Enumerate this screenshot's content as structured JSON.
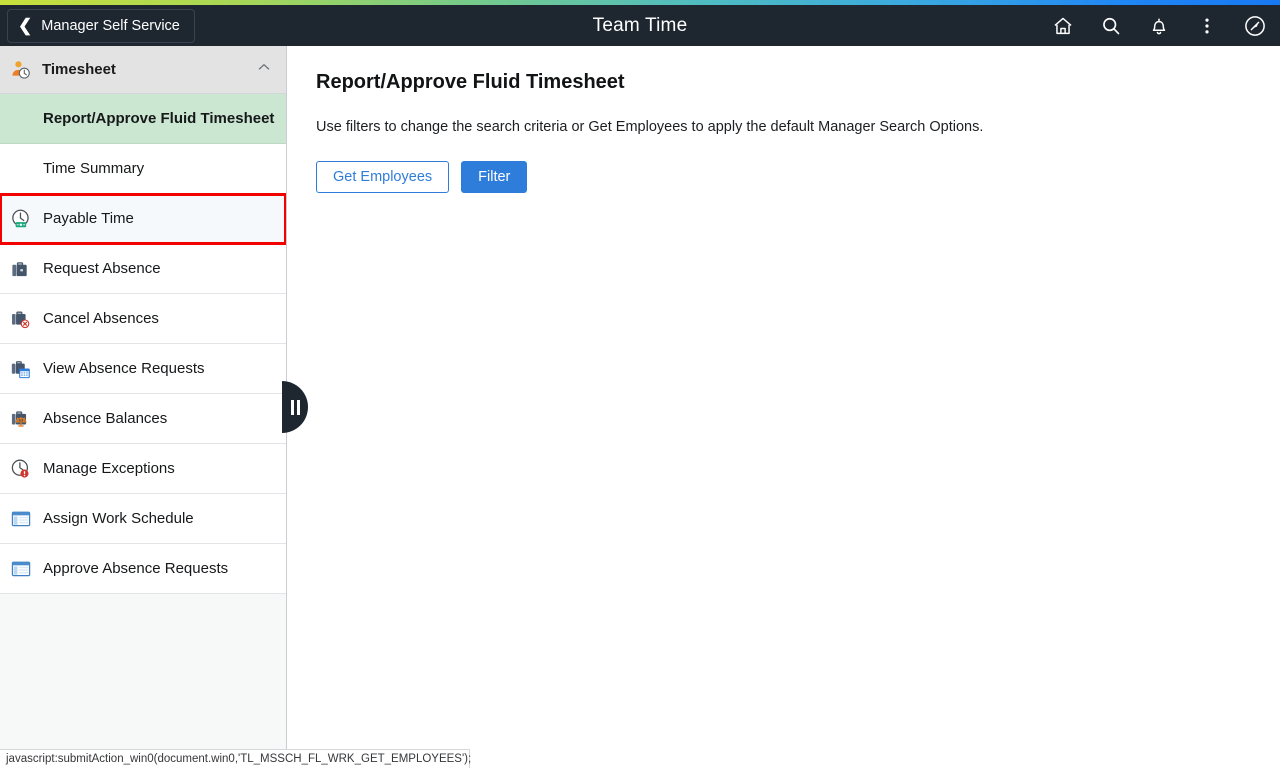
{
  "header": {
    "back_label": "Manager Self Service",
    "back_icon": "chevron-left-icon",
    "title": "Team Time",
    "icons": [
      {
        "name": "home-icon",
        "label": "Home"
      },
      {
        "name": "search-icon",
        "label": "Search"
      },
      {
        "name": "notifications-bell-icon",
        "label": "Notifications"
      },
      {
        "name": "actions-kebab-icon",
        "label": "Actions"
      },
      {
        "name": "navbar-compass-icon",
        "label": "NavBar"
      }
    ],
    "background_color": "#1e2630",
    "gradient_colors": [
      "#c8e03c",
      "#4fbcc2",
      "#1878f2"
    ]
  },
  "sidebar": {
    "group": {
      "label": "Timesheet",
      "icon": "person-clock-icon",
      "chevron": "chevron-up-icon",
      "expanded": true
    },
    "collapse_handle": {
      "name": "sidebar-collapse-handle",
      "icon": "pause-bars-icon"
    },
    "selected_background": "#cbe7d2",
    "highlight_color": "#f30000",
    "items": [
      {
        "label": "Report/Approve Fluid Timesheet",
        "icon": null,
        "selected": true,
        "highlighted": false
      },
      {
        "label": "Time Summary",
        "icon": null,
        "selected": false,
        "highlighted": false
      },
      {
        "label": "Payable Time",
        "icon": "clock-payable-icon",
        "selected": false,
        "highlighted": true
      },
      {
        "label": "Request Absence",
        "icon": "briefcase-icon",
        "selected": false,
        "highlighted": false
      },
      {
        "label": "Cancel Absences",
        "icon": "briefcase-cancel-icon",
        "selected": false,
        "highlighted": false
      },
      {
        "label": "View Absence Requests",
        "icon": "briefcase-calendar-icon",
        "selected": false,
        "highlighted": false
      },
      {
        "label": "Absence Balances",
        "icon": "briefcase-balance-icon",
        "selected": false,
        "highlighted": false
      },
      {
        "label": "Manage Exceptions",
        "icon": "clock-alert-icon",
        "selected": false,
        "highlighted": false
      },
      {
        "label": "Assign Work Schedule",
        "icon": "window-form-icon",
        "selected": false,
        "highlighted": false
      },
      {
        "label": "Approve Absence Requests",
        "icon": "window-form-icon",
        "selected": false,
        "highlighted": false
      }
    ]
  },
  "main": {
    "title": "Report/Approve Fluid Timesheet",
    "instruction": "Use filters to change the search criteria or Get Employees to apply the default Manager Search Options.",
    "buttons": {
      "get_employees": "Get Employees",
      "filter": "Filter"
    },
    "accent_color": "#2f7ddb"
  },
  "status_bar": {
    "text": "javascript:submitAction_win0(document.win0,'TL_MSSCH_FL_WRK_GET_EMPLOYEES');"
  }
}
